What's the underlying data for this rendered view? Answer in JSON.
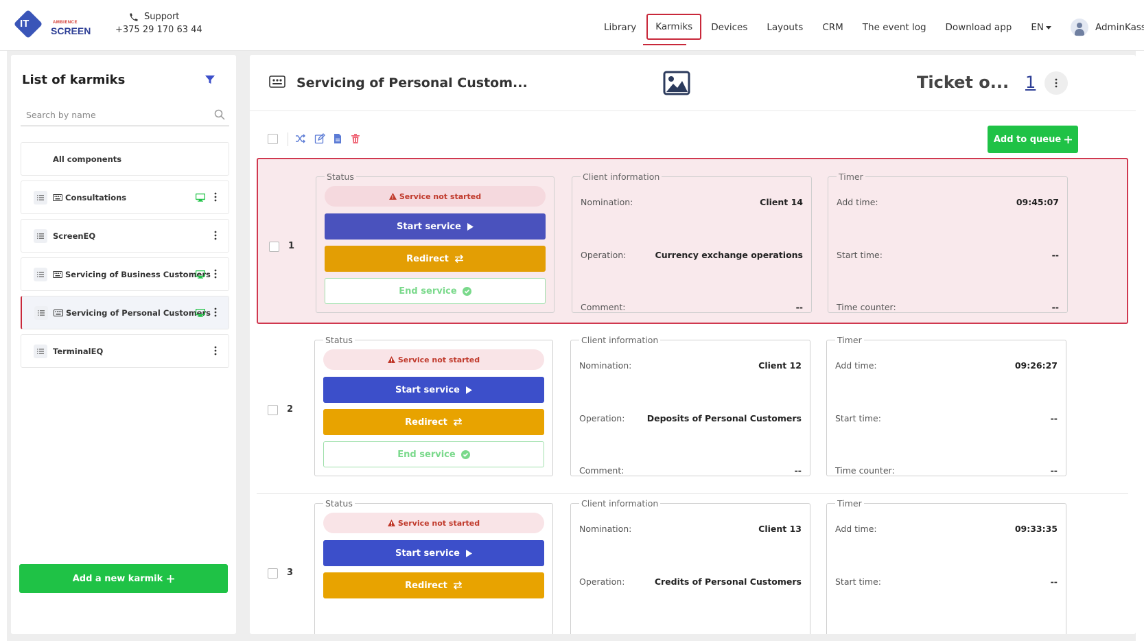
{
  "header": {
    "logo": {
      "it": "IT",
      "ambience": "AMBIENCE",
      "screen": "SCREEN"
    },
    "support_label": "Support",
    "support_phone": "+375 29 170 63 44",
    "nav": [
      "Library",
      "Karmiks",
      "Devices",
      "Layouts",
      "CRM",
      "The event log",
      "Download app"
    ],
    "active_nav": "Karmiks",
    "language": "EN",
    "user": "AdminKass"
  },
  "sidebar": {
    "title": "List of karmiks",
    "search_placeholder": "Search by name",
    "items": [
      {
        "label": "All components",
        "type": "all"
      },
      {
        "label": "Consultations",
        "keyboard": true,
        "monitor": true
      },
      {
        "label": "ScreenEQ",
        "keyboard": false,
        "monitor": false
      },
      {
        "label": "Servicing of Business Customers",
        "keyboard": true,
        "monitor": true
      },
      {
        "label": "Servicing of Personal Customers",
        "keyboard": true,
        "monitor": true,
        "active": true
      },
      {
        "label": "TerminalEQ",
        "keyboard": false,
        "monitor": false
      }
    ],
    "add_button": "Add a new karmik"
  },
  "content": {
    "karmik_title": "Servicing of Personal Custom...",
    "ticket_label": "Ticket o...",
    "ticket_count": "1",
    "add_queue": "Add to queue",
    "labels": {
      "status": "Status",
      "client_info": "Client information",
      "timer": "Timer",
      "not_started": "Service not started",
      "start": "Start service",
      "redirect": "Redirect",
      "end": "End service",
      "nomination": "Nomination:",
      "operation": "Operation:",
      "comment": "Comment:",
      "add_time": "Add time:",
      "start_time": "Start time:",
      "time_counter": "Time counter:"
    },
    "tickets": [
      {
        "num": "1",
        "client": "Client 14",
        "operation": "Currency exchange operations",
        "comment": "--",
        "add_time": "09:45:07",
        "start_time": "--",
        "time_counter": "--",
        "selected": true
      },
      {
        "num": "2",
        "client": "Client 12",
        "operation": "Deposits of Personal Customers",
        "comment": "--",
        "add_time": "09:26:27",
        "start_time": "--",
        "time_counter": "--"
      },
      {
        "num": "3",
        "client": "Client 13",
        "operation": "Credits of Personal Customers",
        "comment": "--",
        "add_time": "09:33:35",
        "start_time": "--",
        "time_counter": "--"
      }
    ]
  },
  "colors": {
    "brand": "#2e3f96",
    "accent_red": "#c8283a",
    "green": "#1fc246",
    "start_blue": "#3c4fca",
    "redirect_orange": "#e8a300"
  }
}
